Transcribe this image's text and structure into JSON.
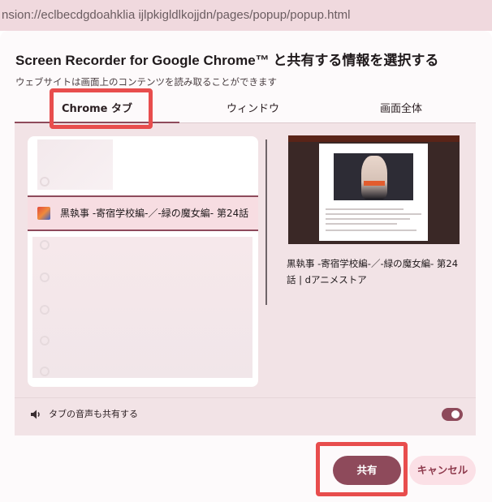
{
  "address_bar": {
    "url_text": "nsion://eclbecdgdoahklia ijlpkigldlkojjdn/pages/popup/popup.html"
  },
  "dialog": {
    "title": "Screen Recorder for Google Chrome™ と共有する情報を選択する",
    "subtitle": "ウェブサイトは画面上のコンテンツを読み取ることができます",
    "tabs": [
      {
        "label": "Chrome タブ",
        "selected": true
      },
      {
        "label": "ウィンドウ",
        "selected": false
      },
      {
        "label": "画面全体",
        "selected": false
      }
    ],
    "tab_list": {
      "selected_tab_label": "黒執事 -寄宿学校編-／-緑の魔女編- 第24話"
    },
    "preview": {
      "caption": "黒執事 -寄宿学校編-／-緑の魔女編- 第24話 | dアニメストア"
    },
    "audio": {
      "label": "タブの音声も共有する",
      "enabled": true,
      "icon": "speaker-icon"
    },
    "buttons": {
      "share_label": "共有",
      "cancel_label": "キャンセル"
    }
  },
  "colors": {
    "accent": "#8e4a5b",
    "panel": "#f2e3e6",
    "highlight_box": "#e84d4d"
  }
}
